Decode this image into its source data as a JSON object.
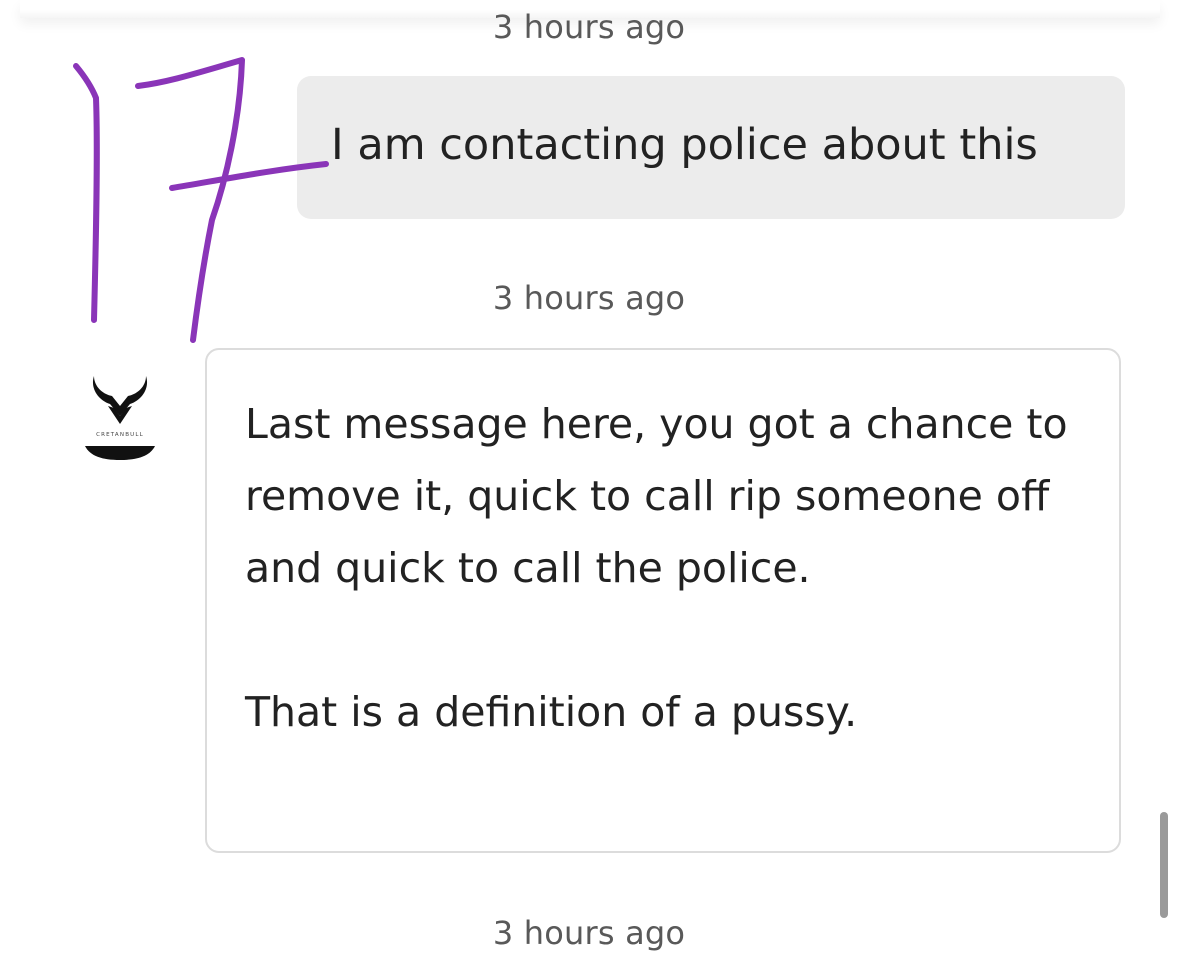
{
  "messages": [
    {
      "timestamp": "3 hours ago",
      "direction": "sent",
      "text": "I am contacting police about this"
    },
    {
      "timestamp": "3 hours ago",
      "direction": "received",
      "paragraphs": [
        "Last message here, you got a chance to remove it, quick to call rip someone off and quick to call the police.",
        "That is a definition of a pussy."
      ]
    },
    {
      "timestamp": "3 hours ago"
    }
  ],
  "avatar": {
    "icon": "bull-logo-icon",
    "wordmark": "CRETANBULL"
  },
  "annotation": {
    "number": "17",
    "color": "#8a35b8"
  },
  "colors": {
    "sent_bubble": "#ececec",
    "received_border": "#dcdcdc",
    "timestamp": "#595959"
  }
}
